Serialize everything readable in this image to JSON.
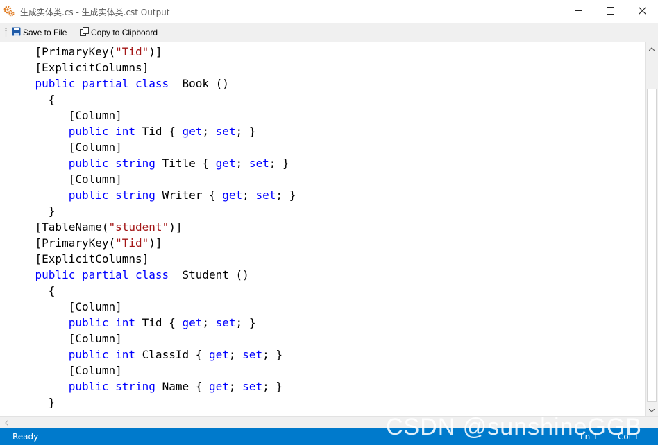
{
  "window": {
    "title": "生成实体类.cs - 生成实体类.cst Output",
    "controls": [
      "minimize-icon",
      "maximize-icon",
      "close-icon"
    ]
  },
  "toolbar": {
    "save_label": "Save to File",
    "copy_label": "Copy to Clipboard"
  },
  "code_lines": [
    [
      {
        "c": "p",
        "t": "    [PrimaryKey("
      },
      {
        "c": "s",
        "t": "\"Tid\""
      },
      {
        "c": "p",
        "t": ")]"
      }
    ],
    [
      {
        "c": "p",
        "t": "    [ExplicitColumns]"
      }
    ],
    [
      {
        "c": "p",
        "t": "    "
      },
      {
        "c": "k",
        "t": "public partial class"
      },
      {
        "c": "p",
        "t": "  Book ()"
      }
    ],
    [
      {
        "c": "p",
        "t": "      {"
      }
    ],
    [
      {
        "c": "p",
        "t": "         [Column]"
      }
    ],
    [
      {
        "c": "p",
        "t": "         "
      },
      {
        "c": "k",
        "t": "public int"
      },
      {
        "c": "p",
        "t": " Tid { "
      },
      {
        "c": "k",
        "t": "get"
      },
      {
        "c": "p",
        "t": "; "
      },
      {
        "c": "k",
        "t": "set"
      },
      {
        "c": "p",
        "t": "; }"
      }
    ],
    [
      {
        "c": "p",
        "t": "         [Column]"
      }
    ],
    [
      {
        "c": "p",
        "t": "         "
      },
      {
        "c": "k",
        "t": "public string"
      },
      {
        "c": "p",
        "t": " Title { "
      },
      {
        "c": "k",
        "t": "get"
      },
      {
        "c": "p",
        "t": "; "
      },
      {
        "c": "k",
        "t": "set"
      },
      {
        "c": "p",
        "t": "; }"
      }
    ],
    [
      {
        "c": "p",
        "t": "         [Column]"
      }
    ],
    [
      {
        "c": "p",
        "t": "         "
      },
      {
        "c": "k",
        "t": "public string"
      },
      {
        "c": "p",
        "t": " Writer { "
      },
      {
        "c": "k",
        "t": "get"
      },
      {
        "c": "p",
        "t": "; "
      },
      {
        "c": "k",
        "t": "set"
      },
      {
        "c": "p",
        "t": "; }"
      }
    ],
    [
      {
        "c": "p",
        "t": "      }"
      }
    ],
    [
      {
        "c": "p",
        "t": "    [TableName("
      },
      {
        "c": "s",
        "t": "\"student\""
      },
      {
        "c": "p",
        "t": ")]"
      }
    ],
    [
      {
        "c": "p",
        "t": "    [PrimaryKey("
      },
      {
        "c": "s",
        "t": "\"Tid\""
      },
      {
        "c": "p",
        "t": ")]"
      }
    ],
    [
      {
        "c": "p",
        "t": "    [ExplicitColumns]"
      }
    ],
    [
      {
        "c": "p",
        "t": "    "
      },
      {
        "c": "k",
        "t": "public partial class"
      },
      {
        "c": "p",
        "t": "  Student ()"
      }
    ],
    [
      {
        "c": "p",
        "t": "      {"
      }
    ],
    [
      {
        "c": "p",
        "t": "         [Column]"
      }
    ],
    [
      {
        "c": "p",
        "t": "         "
      },
      {
        "c": "k",
        "t": "public int"
      },
      {
        "c": "p",
        "t": " Tid { "
      },
      {
        "c": "k",
        "t": "get"
      },
      {
        "c": "p",
        "t": "; "
      },
      {
        "c": "k",
        "t": "set"
      },
      {
        "c": "p",
        "t": "; }"
      }
    ],
    [
      {
        "c": "p",
        "t": "         [Column]"
      }
    ],
    [
      {
        "c": "p",
        "t": "         "
      },
      {
        "c": "k",
        "t": "public int"
      },
      {
        "c": "p",
        "t": " ClassId { "
      },
      {
        "c": "k",
        "t": "get"
      },
      {
        "c": "p",
        "t": "; "
      },
      {
        "c": "k",
        "t": "set"
      },
      {
        "c": "p",
        "t": "; }"
      }
    ],
    [
      {
        "c": "p",
        "t": "         [Column]"
      }
    ],
    [
      {
        "c": "p",
        "t": "         "
      },
      {
        "c": "k",
        "t": "public string"
      },
      {
        "c": "p",
        "t": " Name { "
      },
      {
        "c": "k",
        "t": "get"
      },
      {
        "c": "p",
        "t": "; "
      },
      {
        "c": "k",
        "t": "set"
      },
      {
        "c": "p",
        "t": "; }"
      }
    ],
    [
      {
        "c": "p",
        "t": "      }"
      }
    ]
  ],
  "statusbar": {
    "text": "Ready",
    "position_ln": "Ln 1",
    "position_col": "Col 1"
  },
  "watermark": "CSDN @sunshineGGB",
  "colors": {
    "keyword": "#0000ff",
    "string": "#a31515",
    "statusbar": "#007acc"
  }
}
